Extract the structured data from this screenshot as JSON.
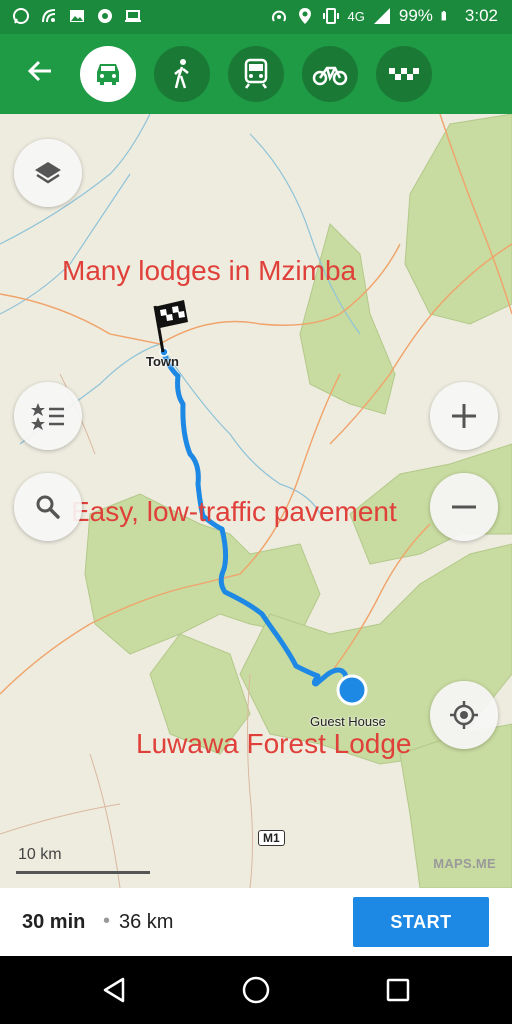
{
  "status": {
    "network": "4G",
    "battery": "99%",
    "time": "3:02"
  },
  "toolbar": {
    "modes": [
      {
        "name": "car",
        "active": true
      },
      {
        "name": "walk",
        "active": false
      },
      {
        "name": "transit",
        "active": false
      },
      {
        "name": "bike",
        "active": false
      },
      {
        "name": "taxi",
        "active": false
      }
    ]
  },
  "map": {
    "annotations": {
      "top": "Many lodges in Mzimba",
      "middle": "Easy, low-traffic pavement",
      "bottom": "Luwawa Forest Lodge"
    },
    "labels": {
      "start_place": "Town",
      "end_place": "Guest House",
      "road": "M1"
    },
    "scale": "10 km",
    "brand": "MAPS.ME"
  },
  "route": {
    "time": "30 min",
    "separator": "•",
    "distance": "36 km",
    "start_label": "START"
  },
  "colors": {
    "toolbar": "#1f9a45",
    "route": "#1e88e5",
    "annotation": "#e0403a"
  }
}
